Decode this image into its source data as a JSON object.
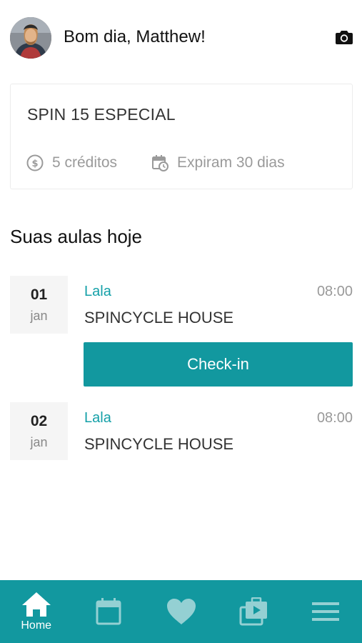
{
  "header": {
    "greeting": "Bom dia, Matthew!",
    "avatar_icon": "user-avatar",
    "camera_icon": "camera-icon"
  },
  "plan": {
    "name": "SPIN 15 ESPECIAL",
    "credits": "5 créditos",
    "expires": "Expiram 30 dias",
    "credits_icon": "dollar-coin-icon",
    "expires_icon": "calendar-clock-icon"
  },
  "classes": {
    "title": "Suas aulas hoje",
    "items": [
      {
        "day": "01",
        "month": "jan",
        "instructor": "Lala",
        "time": "08:00",
        "studio": "SPINCYCLE HOUSE",
        "action": "Check-in"
      },
      {
        "day": "02",
        "month": "jan",
        "instructor": "Lala",
        "time": "08:00",
        "studio": "SPINCYCLE HOUSE"
      }
    ]
  },
  "nav": {
    "items": [
      {
        "label": "Home",
        "icon": "home-icon",
        "active": true
      },
      {
        "label": "",
        "icon": "calendar-icon",
        "active": false
      },
      {
        "label": "",
        "icon": "heart-icon",
        "active": false
      },
      {
        "label": "",
        "icon": "packages-icon",
        "active": false
      },
      {
        "label": "",
        "icon": "menu-icon",
        "active": false
      }
    ]
  },
  "colors": {
    "accent": "#12989f",
    "accent_text": "#14a0a8",
    "muted": "#9a9a9a",
    "date_bg": "#f5f5f5"
  }
}
